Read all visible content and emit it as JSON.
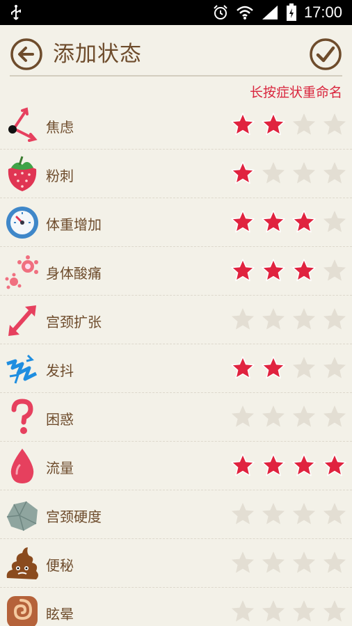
{
  "status_bar": {
    "time": "17:00"
  },
  "header": {
    "title": "添加状态",
    "back_icon": "back-arrow-icon",
    "confirm_icon": "checkmark-icon"
  },
  "hint": "长按症状重命名",
  "colors": {
    "star_on": "#e0233f",
    "star_off": "#e3ded3",
    "accent": "#d9253d",
    "text": "#6e4c2c"
  },
  "symptoms": [
    {
      "label": "焦虑",
      "icon": "clock-hands-icon",
      "rating": 2
    },
    {
      "label": "粉刺",
      "icon": "strawberry-icon",
      "rating": 1
    },
    {
      "label": "体重增加",
      "icon": "scale-dial-icon",
      "rating": 3
    },
    {
      "label": "身体酸痛",
      "icon": "pain-burst-icon",
      "rating": 3
    },
    {
      "label": "宫颈扩张",
      "icon": "expand-arrows-icon",
      "rating": 0
    },
    {
      "label": "发抖",
      "icon": "shiver-zigzag-icon",
      "rating": 2
    },
    {
      "label": "困惑",
      "icon": "question-mark-icon",
      "rating": 0
    },
    {
      "label": "流量",
      "icon": "blood-drop-icon",
      "rating": 4
    },
    {
      "label": "宫颈硬度",
      "icon": "rock-icon",
      "rating": 0
    },
    {
      "label": "便秘",
      "icon": "poop-icon",
      "rating": 0
    },
    {
      "label": "眩晕",
      "icon": "spiral-icon",
      "rating": 0
    }
  ],
  "max_rating": 4
}
